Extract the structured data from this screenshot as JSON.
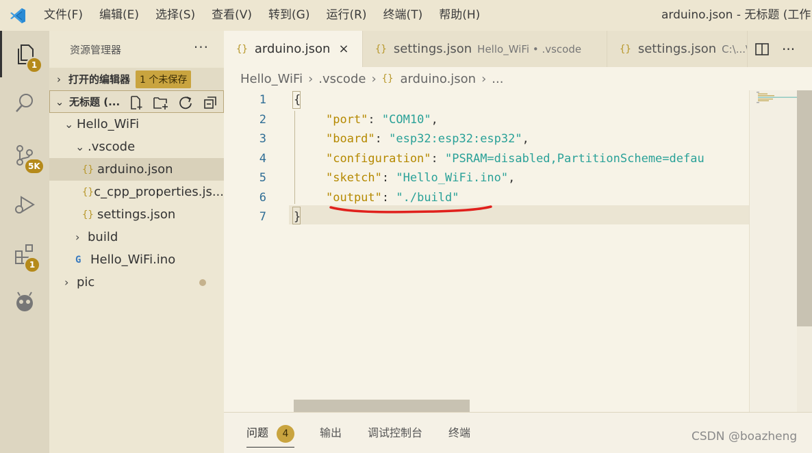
{
  "menu": [
    "文件(F)",
    "编辑(E)",
    "选择(S)",
    "查看(V)",
    "转到(G)",
    "运行(R)",
    "终端(T)",
    "帮助(H)"
  ],
  "window_title": "arduino.json - 无标题 (工作区)",
  "activity": {
    "explorer_badge": "1",
    "scm_badge": "5K",
    "extensions_badge": "1"
  },
  "sidebar": {
    "title": "资源管理器",
    "more": "···",
    "open_editors": {
      "label": "打开的编辑器",
      "badge": "1 个未保存"
    },
    "workspace": {
      "label": "无标题 (..."
    },
    "tree": [
      {
        "label": "Hello_WiFi",
        "kind": "folder-open",
        "depth": 1
      },
      {
        "label": ".vscode",
        "kind": "folder-open",
        "depth": 2
      },
      {
        "label": "arduino.json",
        "kind": "json",
        "depth": 3,
        "selected": true
      },
      {
        "label": "c_cpp_properties.js...",
        "kind": "json",
        "depth": 3
      },
      {
        "label": "settings.json",
        "kind": "json",
        "depth": 3
      },
      {
        "label": "build",
        "kind": "folder",
        "depth": 2
      },
      {
        "label": "Hello_WiFi.ino",
        "kind": "cpp",
        "depth": 2
      },
      {
        "label": "pic",
        "kind": "folder",
        "depth": 1,
        "modified": true
      }
    ]
  },
  "tabs": [
    {
      "label": "arduino.json",
      "desc": "",
      "active": true,
      "close": "×"
    },
    {
      "label": "settings.json",
      "desc": "Hello_WiFi • .vscode",
      "active": false
    },
    {
      "label": "settings.json",
      "desc": "C:\\...\\",
      "active": false
    }
  ],
  "json_icon": "{}",
  "breadcrumb": [
    "Hello_WiFi",
    ".vscode",
    "arduino.json",
    "..."
  ],
  "code_lines": [
    {
      "n": "1",
      "parts": [
        [
          "p",
          "{"
        ]
      ]
    },
    {
      "n": "2",
      "parts": [
        [
          "k",
          "\"port\""
        ],
        [
          "p",
          ": "
        ],
        [
          "s",
          "\"COM10\""
        ],
        [
          "p",
          ","
        ]
      ]
    },
    {
      "n": "3",
      "parts": [
        [
          "k",
          "\"board\""
        ],
        [
          "p",
          ": "
        ],
        [
          "s",
          "\"esp32:esp32:esp32\""
        ],
        [
          "p",
          ","
        ]
      ]
    },
    {
      "n": "4",
      "parts": [
        [
          "k",
          "\"configuration\""
        ],
        [
          "p",
          ": "
        ],
        [
          "s",
          "\"PSRAM=disabled,PartitionScheme=defau"
        ]
      ]
    },
    {
      "n": "5",
      "parts": [
        [
          "k",
          "\"sketch\""
        ],
        [
          "p",
          ": "
        ],
        [
          "s",
          "\"Hello_WiFi.ino\""
        ],
        [
          "p",
          ","
        ]
      ]
    },
    {
      "n": "6",
      "parts": [
        [
          "k",
          "\"output\""
        ],
        [
          "p",
          ": "
        ],
        [
          "s",
          "\"./build\""
        ]
      ]
    },
    {
      "n": "7",
      "parts": [
        [
          "p",
          "}"
        ]
      ]
    }
  ],
  "panel": {
    "tabs": [
      "问题",
      "输出",
      "调试控制台",
      "终端"
    ],
    "problems_count": "4"
  },
  "watermark": "CSDN @boazheng",
  "colors": {
    "annotation": "#e0201c",
    "badge": "#b58a1b",
    "key": "#b58900",
    "string": "#2aa198",
    "line_number": "#2f6d95"
  }
}
